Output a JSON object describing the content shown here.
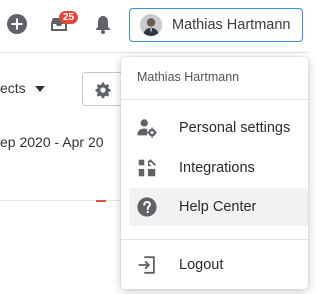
{
  "topbar": {
    "notification_count": "25",
    "user_name": "Mathias Hartmann"
  },
  "background": {
    "project_selector_label": "ects",
    "date_range": "ep 2020 -  Apr 20"
  },
  "user_menu": {
    "header_name": "Mathias Hartmann",
    "items": [
      {
        "label": "Personal settings",
        "icon": "user-gear-icon"
      },
      {
        "label": "Integrations",
        "icon": "integrations-icon"
      },
      {
        "label": "Help Center",
        "icon": "help-circle-icon"
      },
      {
        "label": "Logout",
        "icon": "logout-icon"
      }
    ]
  },
  "colors": {
    "accent_border": "#3a8ee6",
    "badge": "#e04a3a",
    "icon_gray": "#5f6368"
  }
}
